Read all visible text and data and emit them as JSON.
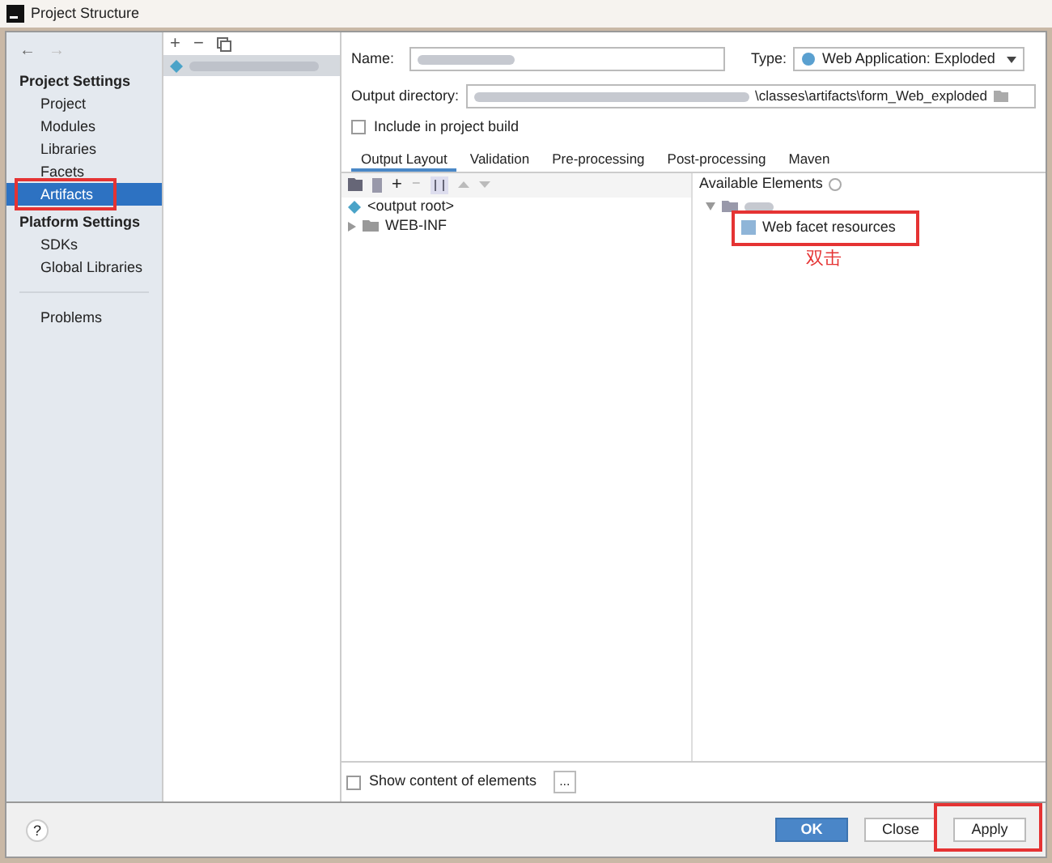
{
  "window": {
    "title": "Project Structure"
  },
  "sidebar": {
    "nav": [
      "←",
      "→"
    ],
    "sections": [
      {
        "heading": "Project Settings",
        "items": [
          {
            "label": "Project",
            "selected": false,
            "annotated": false
          },
          {
            "label": "Modules",
            "selected": false,
            "annotated": false
          },
          {
            "label": "Libraries",
            "selected": false,
            "annotated": false
          },
          {
            "label": "Facets",
            "selected": false,
            "annotated": false
          },
          {
            "label": "Artifacts",
            "selected": true,
            "annotated": true
          }
        ]
      },
      {
        "heading": "Platform Settings",
        "items": [
          {
            "label": "SDKs",
            "selected": false,
            "annotated": false
          },
          {
            "label": "Global Libraries",
            "selected": false,
            "annotated": false
          }
        ]
      },
      {
        "items": [
          {
            "label": "Problems",
            "selected": false,
            "annotated": false
          }
        ]
      }
    ]
  },
  "artifact_list": {
    "toolbar": [
      "+",
      "−"
    ]
  },
  "form": {
    "name_label": "Name:",
    "type_label": "Type:",
    "type_value": "Web Application: Exploded",
    "output_label": "Output directory:",
    "output_value": "\\classes\\artifacts\\form_Web_exploded",
    "include_label": "Include in project build",
    "include_checked": false
  },
  "tabs": [
    {
      "label": "Output Layout",
      "selected": true
    },
    {
      "label": "Validation",
      "selected": false
    },
    {
      "label": "Pre-processing",
      "selected": false
    },
    {
      "label": "Post-processing",
      "selected": false
    },
    {
      "label": "Maven",
      "selected": false
    }
  ],
  "layout_toolbar": [
    "+",
    "−"
  ],
  "layout_tree": [
    {
      "label": "<output root>",
      "kind": "root"
    },
    {
      "label": "WEB-INF",
      "kind": "folder"
    }
  ],
  "available": {
    "heading": "Available Elements",
    "elements": [
      {
        "label": "Web facet resources",
        "annotated": true
      }
    ],
    "note": "双击"
  },
  "show_content": {
    "label": "Show content of elements",
    "checked": false,
    "button": "..."
  },
  "help": "?",
  "buttons": [
    {
      "label": "OK",
      "kind": "primary",
      "annotated": false
    },
    {
      "label": "Close",
      "kind": "normal",
      "annotated": false
    },
    {
      "label": "Apply",
      "kind": "normal",
      "annotated": true
    }
  ]
}
